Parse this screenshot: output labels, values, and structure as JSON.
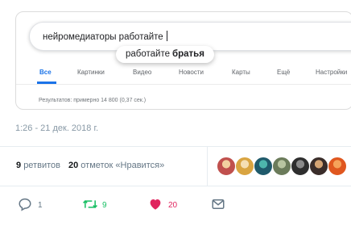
{
  "search": {
    "query": "нейромедиаторы работайте",
    "suggestion_prefix": "работайте",
    "suggestion_bold": "братья",
    "tabs": [
      {
        "label": "Все",
        "active": true
      },
      {
        "label": "Картинки",
        "active": false
      },
      {
        "label": "Видео",
        "active": false
      },
      {
        "label": "Новости",
        "active": false
      },
      {
        "label": "Карты",
        "active": false
      },
      {
        "label": "Ещё",
        "active": false
      },
      {
        "label": "Настройки",
        "active": false
      }
    ],
    "results_text": "Результатов: примерно 14 800 (0,37 сек.)",
    "accent_color": "#1a73e8"
  },
  "tweet": {
    "timestamp": "1:26 - 21 дек. 2018 г.",
    "retweets_count": "9",
    "retweets_label": "ретвитов",
    "likes_count": "20",
    "likes_label": "отметок «Нравится»",
    "liker_avatars": [
      {
        "color": "#c0504d",
        "accent": "#f2d0a0"
      },
      {
        "color": "#d9a441",
        "accent": "#f5deb3"
      },
      {
        "color": "#1f5a6b",
        "accent": "#4db6ac"
      },
      {
        "color": "#6b7b5a",
        "accent": "#b8c4a0"
      },
      {
        "color": "#2e2e2e",
        "accent": "#8a8a8a"
      },
      {
        "color": "#3a2d2a",
        "accent": "#d4a373"
      },
      {
        "color": "#e0571f",
        "accent": "#f6a25a"
      }
    ],
    "actions": {
      "reply": {
        "icon": "reply-icon",
        "count": "1",
        "color": "#657786"
      },
      "retweet": {
        "icon": "retweet-icon",
        "count": "9",
        "color": "#17bf63"
      },
      "like": {
        "icon": "heart-icon",
        "count": "20",
        "color": "#e0245e"
      },
      "message": {
        "icon": "envelope-icon",
        "color": "#657786"
      }
    }
  }
}
